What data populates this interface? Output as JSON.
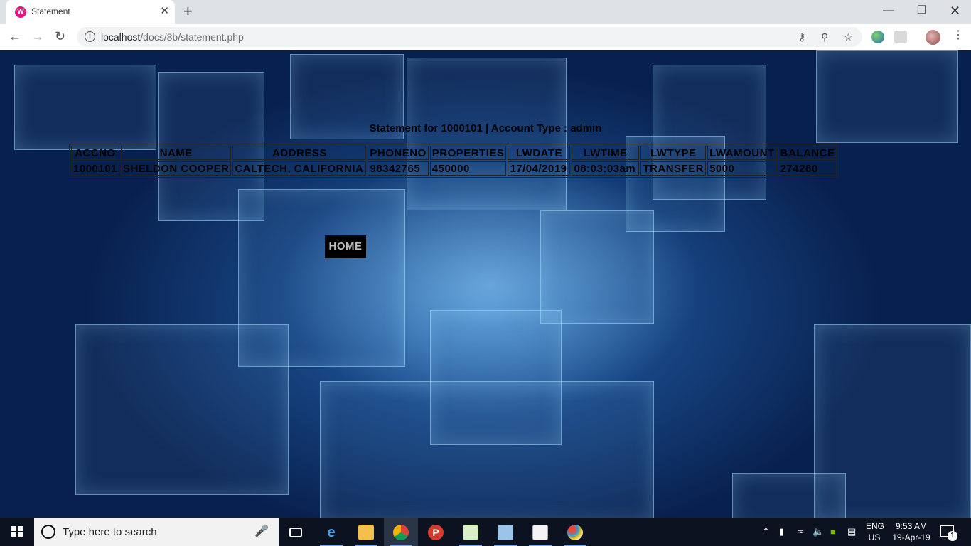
{
  "browser": {
    "tab": {
      "favicon": "W",
      "title": "Statement",
      "close_glyph": "✕"
    },
    "new_tab_glyph": "+",
    "window_controls": {
      "minimize": "—",
      "maximize": "❐",
      "close": "✕"
    },
    "url_host": "localhost",
    "url_path": "/docs/8b/statement.php"
  },
  "page": {
    "heading": "Statement for 1000101 | Account Type : admin",
    "table": {
      "columns": [
        "ACCNO",
        "NAME",
        "ADDRESS",
        "PHONENO",
        "PROPERTIES",
        "LWDATE",
        "LWTIME",
        "LWTYPE",
        "LWAMOUNT",
        "BALANCE"
      ],
      "rows": [
        [
          "1000101",
          "SHELDON COOPER",
          "CALTECH, CALIFORNIA",
          "98342765",
          "450000",
          "17/04/2019",
          "08:03:03am",
          "TRANSFER",
          "5000",
          "274280"
        ]
      ]
    },
    "home_label": "HOME"
  },
  "taskbar": {
    "search_placeholder": "Type here to search",
    "language_line1": "ENG",
    "language_line2": "US",
    "time": "9:53 AM",
    "date": "19-Apr-19",
    "notification_count": "1",
    "icons": [
      "task-view-icon",
      "edge-icon",
      "file-explorer-icon",
      "chrome-icon",
      "p-app-icon",
      "notepad-icon",
      "box-app-icon",
      "document-app-icon",
      "paint-icon"
    ]
  }
}
